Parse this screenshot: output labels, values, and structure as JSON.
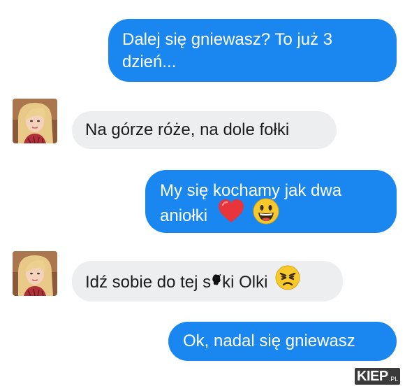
{
  "conversation": {
    "messages": [
      {
        "from": "me",
        "text_lines": [
          "Dalej się gniewasz? To już 3",
          "dzień..."
        ]
      },
      {
        "from": "contact",
        "text": "Na górze róże, na dole fołki"
      },
      {
        "from": "me",
        "text_lines": [
          "My się kochamy jak dwa",
          "aniołki"
        ],
        "emojis": [
          "red-heart",
          "grinning-face"
        ]
      },
      {
        "from": "contact",
        "text_before_blot": "Idź sobie do tej s",
        "text_after_blot": "ki Olki",
        "emojis": [
          "angry-face"
        ]
      },
      {
        "from": "me",
        "text": "Ok, nadal się gniewasz"
      }
    ]
  },
  "watermark": {
    "main": "KIEP",
    "suffix": ".PL"
  },
  "colors": {
    "outgoing_bubble": "#1a86f0",
    "incoming_bubble": "#eceeef",
    "outgoing_text": "#ffffff",
    "incoming_text": "#1c1c1c",
    "emoji_yellow": "#f7c92b",
    "heart_red": "#e8343b"
  }
}
